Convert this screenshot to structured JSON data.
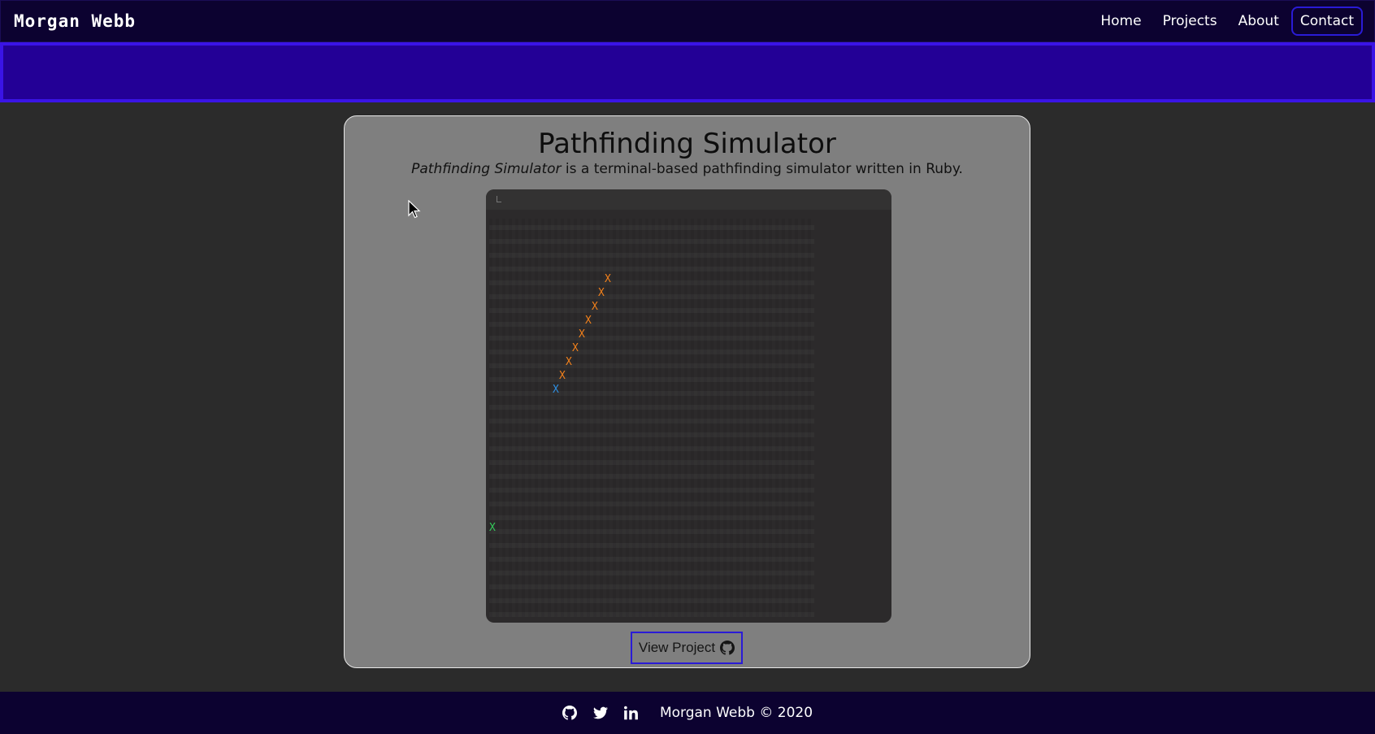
{
  "brand": "Morgan Webb",
  "nav": {
    "items": [
      {
        "label": "Home"
      },
      {
        "label": "Projects"
      },
      {
        "label": "About"
      },
      {
        "label": "Contact"
      }
    ]
  },
  "project": {
    "title": "Pathfinding Simulator",
    "description_italic": "Pathfinding Simulator",
    "description_rest": " is a terminal-based pathfinding simulator written in Ruby.",
    "view_button_label": "View Project"
  },
  "terminal": {
    "path_marker": "X",
    "start_marker": "X",
    "goal_marker": "X"
  },
  "footer": {
    "icons": [
      "github-icon",
      "twitter-icon",
      "linkedin-icon"
    ],
    "text": "Morgan Webb © 2020"
  },
  "colors": {
    "nav_bg": "#0c0230",
    "banner_bg": "#230096",
    "accent": "#2a1bd6",
    "card_bg": "#7f7f7f",
    "page_bg": "#2b2b2b",
    "path_marker": "#f0801c",
    "start_marker": "#2f8fe0",
    "goal_marker": "#34c759"
  }
}
